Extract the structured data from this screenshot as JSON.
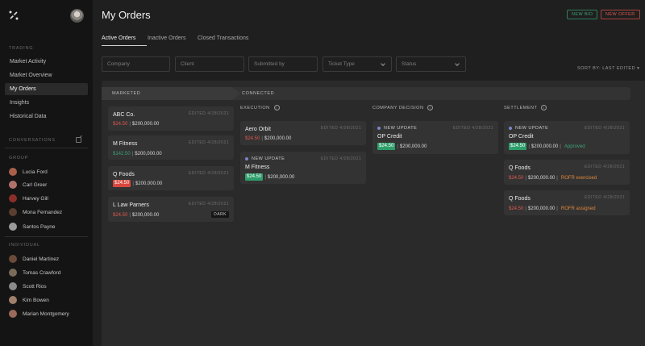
{
  "sidebar": {
    "sections": {
      "trading": "TRADING",
      "conversations": "CONVERSATIONS",
      "group": "GROUP",
      "individual": "INDIVIDUAL"
    },
    "nav": [
      "Market Activity",
      "Market Overview",
      "My Orders",
      "Insights",
      "Historical Data"
    ],
    "group": [
      "Lucia Ford",
      "Carl Greer",
      "Harvey Gill",
      "Mona Fernandez",
      "Santos Payne"
    ],
    "individual": [
      "Daniel Martinez",
      "Tomas Crawford",
      "Scott Rios",
      "Kim Bowen",
      "Marian Montgomery"
    ]
  },
  "header": {
    "title": "My Orders",
    "new_bid": "NEW BID",
    "new_offer": "NEW OFFER"
  },
  "tabs": [
    "Active Orders",
    "Inactive Orders",
    "Closed Transactions"
  ],
  "filters": {
    "company": "Company",
    "client": "Client",
    "submitted_by": "Submitted by",
    "ticket_type": "Ticket Type",
    "status": "Status"
  },
  "sort_label": "SORT BY: LAST EDITED",
  "stages": {
    "marketed": "MARKETED",
    "connected": "CONNECTED"
  },
  "columns": {
    "execution": "EXECUTION",
    "company_decision": "COMPANY DECISION",
    "settlement": "SETTLEMENT"
  },
  "marketed": [
    {
      "name": "ABC Co.",
      "edited": "EDITED 4/28/2021",
      "price": "$24.50",
      "amount": "$200,000.00"
    },
    {
      "name": "M Fitness",
      "edited": "EDITED 4/28/2021",
      "price": "$142.50",
      "amount": "$200,000.00"
    },
    {
      "name": "Q Foods",
      "edited": "EDITED 4/28/2021",
      "price": "$24.50",
      "amount": "$200,000.00"
    },
    {
      "name": "L Law Parners",
      "edited": "EDITED 4/28/2021",
      "price": "$24.50",
      "amount": "$200,000.00",
      "badge": "DARK"
    }
  ],
  "execution": [
    {
      "name": "Aero Orbit",
      "edited": "EDITED 4/28/2021",
      "price": "$24.50",
      "amount": "$200,000.00"
    },
    {
      "new_update": "NEW UPDATE",
      "name": "M Fitness",
      "edited": "EDITED 4/28/2021",
      "price": "$24.50",
      "amount": "$200,000.00"
    }
  ],
  "company_decision": [
    {
      "new_update": "NEW UPDATE",
      "name": "OP Credit",
      "edited": "EDITED 4/28/2021",
      "price": "$24.50",
      "amount": "$200,000.00"
    }
  ],
  "settlement": [
    {
      "new_update": "NEW UPDATE",
      "name": "OP Credit",
      "edited": "EDITED 4/28/2021",
      "price": "$24.50",
      "amount": "$200,000.00",
      "status": "Approved"
    },
    {
      "name": "Q Foods",
      "edited": "EDITED 4/28/2021",
      "price": "$24.50",
      "amount": "$200,000.00",
      "status": "ROFR exercised"
    },
    {
      "name": "Q Foods",
      "edited": "EDITED 4/28/2021",
      "price": "$24.50",
      "amount": "$200,000.00",
      "status": "ROFR assigned"
    }
  ],
  "colors": {
    "green": "#3ea37a",
    "red": "#e0594f",
    "orange": "#e0863c",
    "update_dot": "#7b86c9"
  }
}
